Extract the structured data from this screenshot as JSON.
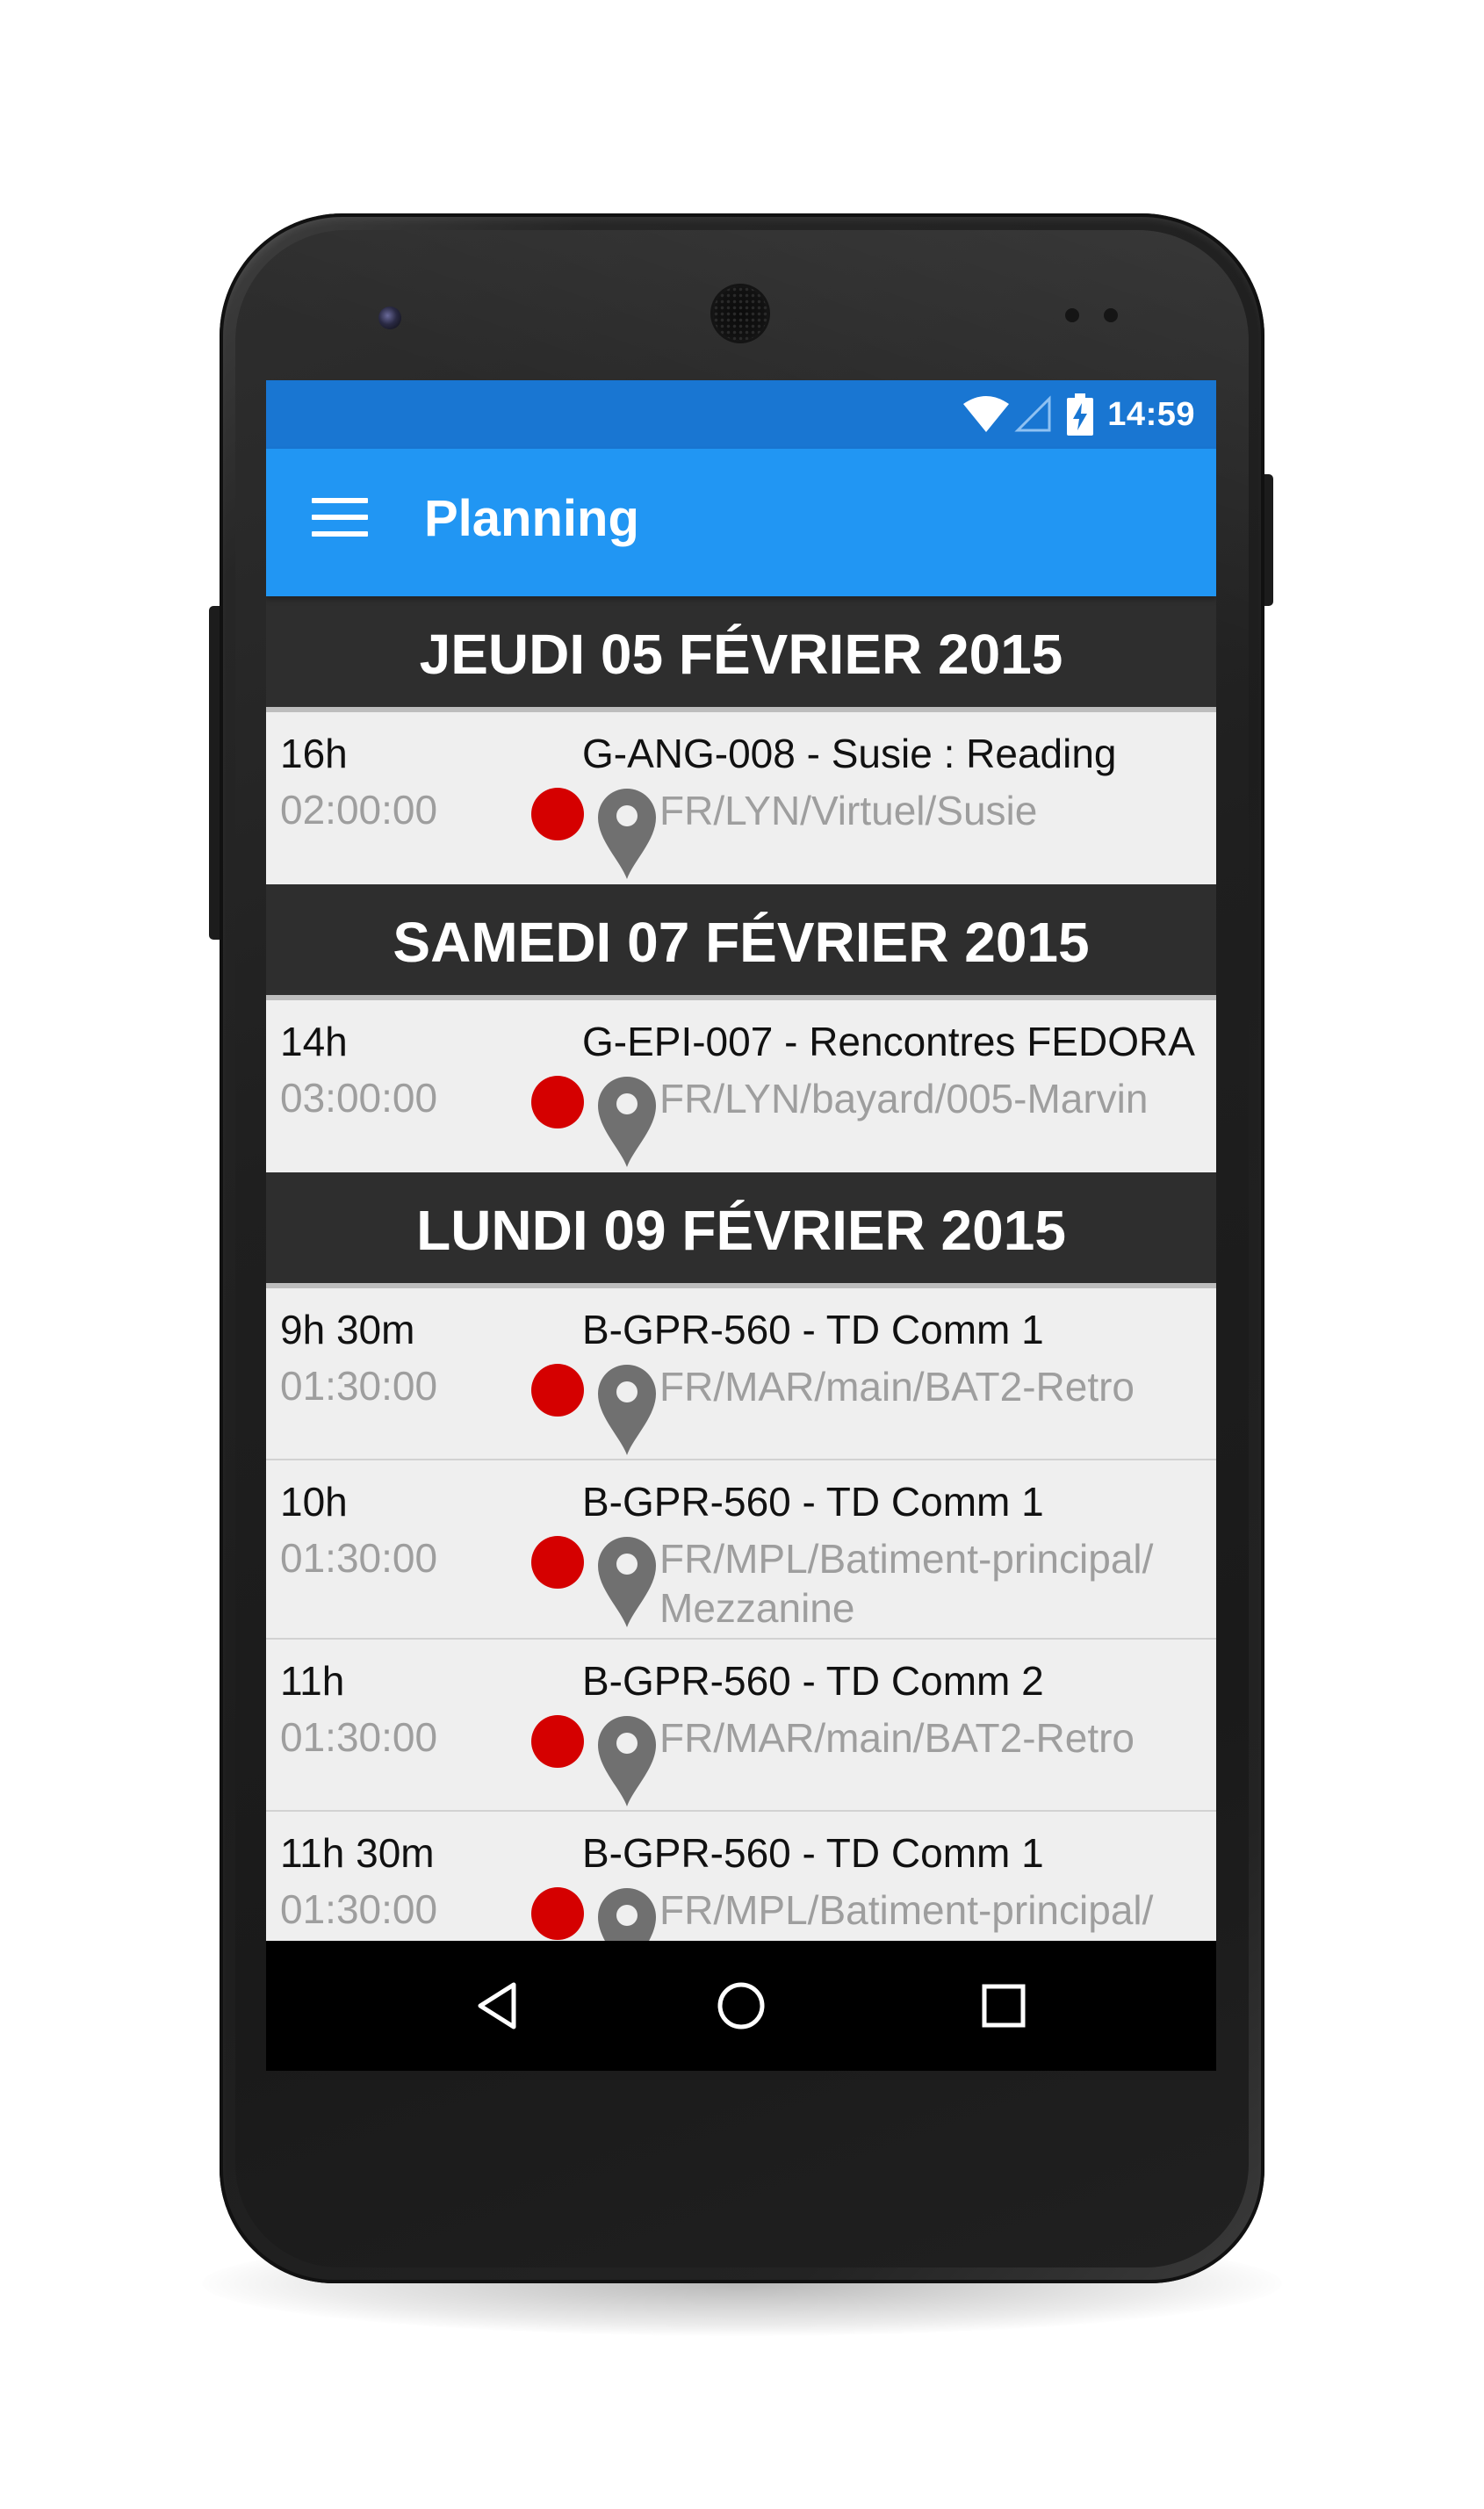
{
  "status_bar": {
    "time": "14:59",
    "icons": [
      "wifi-icon",
      "cell-signal-icon",
      "battery-charging-icon"
    ]
  },
  "app_bar": {
    "title": "Planning",
    "menu_icon": "hamburger-menu-icon"
  },
  "days": [
    {
      "label": "JEUDI 05 FÉVRIER 2015",
      "events": [
        {
          "time": "16h",
          "duration": "02:00:00",
          "title": "G-ANG-008 - Susie : Reading",
          "location": "FR/LYN/Virtuel/Susie"
        }
      ]
    },
    {
      "label": "SAMEDI 07 FÉVRIER 2015",
      "events": [
        {
          "time": "14h",
          "duration": "03:00:00",
          "title": "G-EPI-007 - Rencontres FEDORA",
          "location": "FR/LYN/bayard/005-Marvin"
        }
      ]
    },
    {
      "label": "LUNDI 09 FÉVRIER 2015",
      "events": [
        {
          "time": "9h 30m",
          "duration": "01:30:00",
          "title": "B-GPR-560 - TD Comm 1",
          "location": "FR/MAR/main/BAT2-Retro"
        },
        {
          "time": "10h",
          "duration": "01:30:00",
          "title": "B-GPR-560 - TD Comm 1",
          "location": "FR/MPL/Batiment-principal/ Mezzanine"
        },
        {
          "time": "11h",
          "duration": "01:30:00",
          "title": "B-GPR-560 - TD Comm 2",
          "location": "FR/MAR/main/BAT2-Retro"
        },
        {
          "time": "11h 30m",
          "duration": "01:30:00",
          "title": "B-GPR-560 - TD Comm 1",
          "location": "FR/MPL/Batiment-principal/"
        }
      ]
    }
  ],
  "navigation": {
    "back": "back-triangle-icon",
    "home": "home-circle-icon",
    "recents": "recents-square-icon"
  },
  "colors": {
    "status_bar": "#1976D2",
    "app_bar": "#2196F3",
    "day_header": "#2E2E2E",
    "event_bg": "#EFEFEF",
    "status_dot": "#D50000",
    "pin": "#707070",
    "secondary_text": "#9E9E9E"
  }
}
